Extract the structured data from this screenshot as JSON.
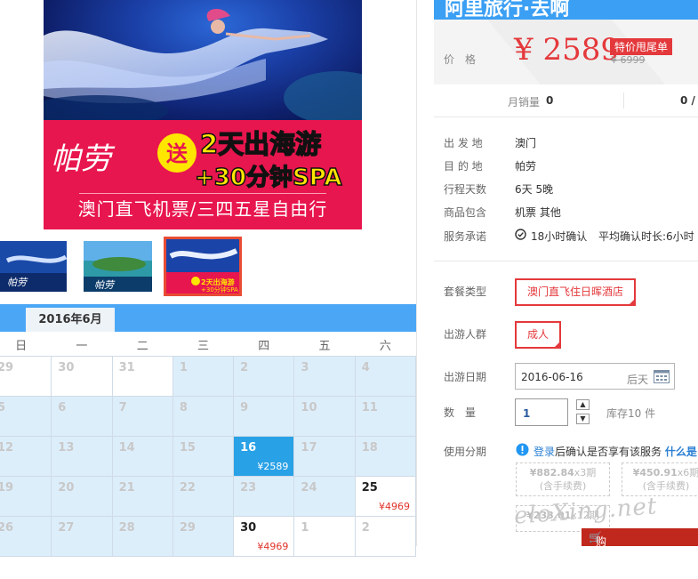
{
  "hero": {
    "slogan_name": "帕劳",
    "slogan_gift": "送",
    "slogan_line1": "2天出海游",
    "slogan_line2": "+30分钟SPA",
    "subtitle": "澳门直飞机票/三四五星自由行"
  },
  "thumbnails": [
    {
      "label": "thumbnail 1",
      "selected": false
    },
    {
      "label": "thumbnail 2",
      "selected": false
    },
    {
      "label": "thumbnail 3",
      "selected": true
    }
  ],
  "calendar": {
    "month": "2016年6月",
    "weekdays": [
      "日",
      "一",
      "二",
      "三",
      "四",
      "五",
      "六"
    ],
    "weeks": [
      [
        {
          "d": "29"
        },
        {
          "d": "30"
        },
        {
          "d": "31"
        },
        {
          "d": "1"
        },
        {
          "d": "2"
        },
        {
          "d": "3"
        },
        {
          "d": "4"
        }
      ],
      [
        {
          "d": "5"
        },
        {
          "d": "6"
        },
        {
          "d": "7"
        },
        {
          "d": "8"
        },
        {
          "d": "9"
        },
        {
          "d": "10"
        },
        {
          "d": "11"
        }
      ],
      [
        {
          "d": "12"
        },
        {
          "d": "13"
        },
        {
          "d": "14"
        },
        {
          "d": "15"
        },
        {
          "d": "16",
          "price": "¥2589",
          "state": "selected"
        },
        {
          "d": "17"
        },
        {
          "d": "18"
        }
      ],
      [
        {
          "d": "19"
        },
        {
          "d": "20"
        },
        {
          "d": "21"
        },
        {
          "d": "22"
        },
        {
          "d": "23"
        },
        {
          "d": "24"
        },
        {
          "d": "25",
          "price": "¥4969",
          "state": "available"
        }
      ],
      [
        {
          "d": "26"
        },
        {
          "d": "27"
        },
        {
          "d": "28"
        },
        {
          "d": "29"
        },
        {
          "d": "30",
          "price": "¥4969",
          "state": "available"
        },
        {
          "d": "1"
        },
        {
          "d": "2"
        }
      ]
    ]
  },
  "product": {
    "shop_title": "阿里旅行·去啊",
    "price_label": "价　格",
    "price": "¥ 2589",
    "promo_badge": "特价甩尾单",
    "original_price": "¥ 6999",
    "monthly_sales_label": "月销量",
    "monthly_sales_value": "0",
    "other_count": "0 /",
    "details": [
      {
        "k": "出 发 地",
        "v": "澳门"
      },
      {
        "k": "目 的 地",
        "v": "帕劳"
      },
      {
        "k": "行程天数",
        "v": "6天 5晚"
      },
      {
        "k": "商品包含",
        "v": "机票  其他"
      }
    ],
    "service_label": "服务承诺",
    "service_confirm": "18小时确认",
    "service_avg": "平均确认时长:6小时"
  },
  "options": {
    "package_label": "套餐类型",
    "package_value": "澳门直飞住日晖酒店",
    "people_label": "出游人群",
    "people_value": "成人",
    "date_label": "出游日期",
    "date_value": "2016-06-16",
    "date_hint": "后天",
    "qty_label": "数　量",
    "qty_value": "1",
    "stock": "库存10 件",
    "installment_label": "使用分期",
    "installment_login": "登录",
    "installment_text": "后确认是否享有该服务",
    "installment_what": "什么是",
    "plans": [
      {
        "amount": "¥882.84",
        "period": "x3期",
        "fee": "(含手续费)"
      },
      {
        "amount": "¥450.91",
        "period": "x6期",
        "fee": "(含手续费)"
      },
      {
        "amount": "¥233.01",
        "period": "x12期",
        "fee": ""
      }
    ]
  },
  "watermark": "eloXing.net",
  "cart": "购物车",
  "colors": {
    "accent": "#e4393c",
    "blue": "#4ba7f5",
    "calendar_selected": "#28a1e6"
  }
}
